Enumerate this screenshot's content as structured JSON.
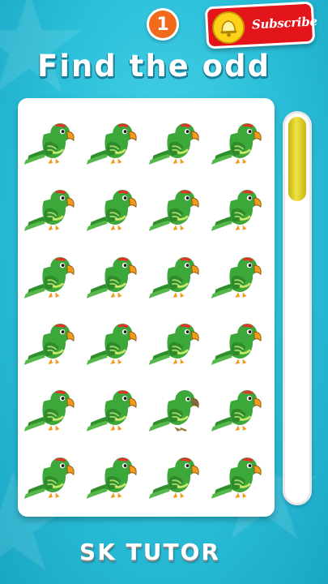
{
  "level_number": "1",
  "subscribe_label": "Subscribe",
  "title": "Find the odd",
  "brand": "SK TUTOR",
  "timer_fraction": 0.22,
  "colors": {
    "background": "#2bbfd9",
    "title_shadow": "#1b7f97",
    "badge": "#f26a1b",
    "subscribe": "#e4141b",
    "timer_fill": "#efe246",
    "parrot_green": "#3da83a",
    "beak_orange": "#f29a1a",
    "odd_beak": "#7a6a4a"
  },
  "puzzle": {
    "rows": 6,
    "columns": 4,
    "item_icon": "parrot-icon",
    "odd_item": {
      "row": 5,
      "column": 3
    }
  }
}
